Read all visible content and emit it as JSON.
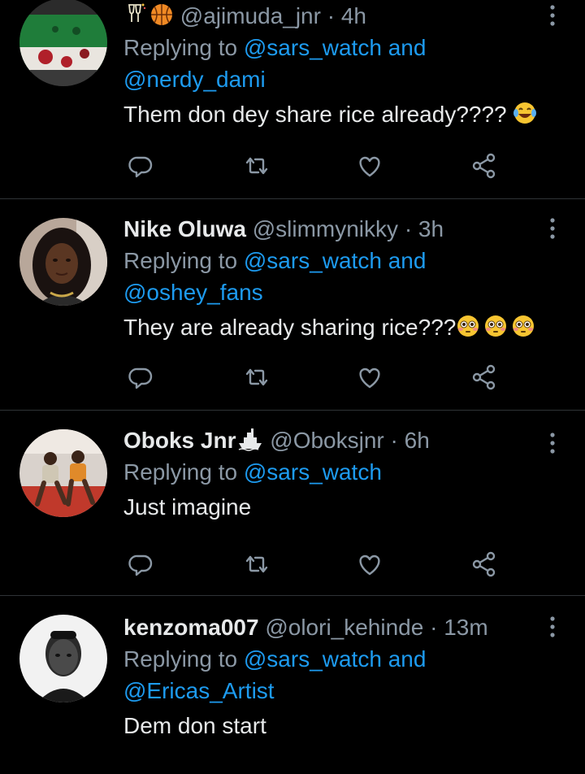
{
  "colors": {
    "background": "#000000",
    "text": "#e7e9ea",
    "muted": "#8b98a5",
    "accent": "#1d9bf0",
    "divider": "#2f3336"
  },
  "icons": {
    "more": "more-vertical-icon",
    "reply": "reply-icon",
    "retweet": "retweet-icon",
    "like": "heart-icon",
    "share": "share-icon"
  },
  "tweets": [
    {
      "name": "",
      "name_emojis": [
        "champagne-icon",
        "basketball-icon"
      ],
      "handle": "@ajimuda_jnr",
      "separator": "·",
      "time": "4h",
      "replying_prefix": "Replying to",
      "replying_line1_mention": "@sars_watch",
      "replying_line1_and": "and",
      "replying_line2_mention": "@nerdy_dami",
      "text": "Them don dey share rice already????",
      "text_emojis": [
        "laughing-tears-emoji"
      ]
    },
    {
      "name": "Nike Oluwa",
      "handle": "@slimmynikky",
      "separator": "·",
      "time": "3h",
      "replying_prefix": "Replying to",
      "replying_line1_mention": "@sars_watch",
      "replying_line1_and": "and",
      "replying_line2_mention": "@oshey_fans",
      "text": "They are already sharing rice???",
      "text_emojis": [
        "flushed-face-emoji",
        "flushed-face-emoji",
        "flushed-face-emoji"
      ]
    },
    {
      "name": "Oboks Jnr",
      "name_emojis": [
        "ship-icon"
      ],
      "handle": "@Oboksjnr",
      "separator": "·",
      "time": "6h",
      "replying_prefix": "Replying to",
      "replying_line1_mention": "@sars_watch",
      "text": "Just imagine"
    },
    {
      "name": "kenzoma007",
      "handle": "@olori_kehinde",
      "separator": "·",
      "time": "13m",
      "replying_prefix": "Replying to",
      "replying_line1_mention": "@sars_watch",
      "replying_line1_and": "and",
      "replying_line2_mention": "@Ericas_Artist",
      "text": "Dem don start"
    }
  ]
}
